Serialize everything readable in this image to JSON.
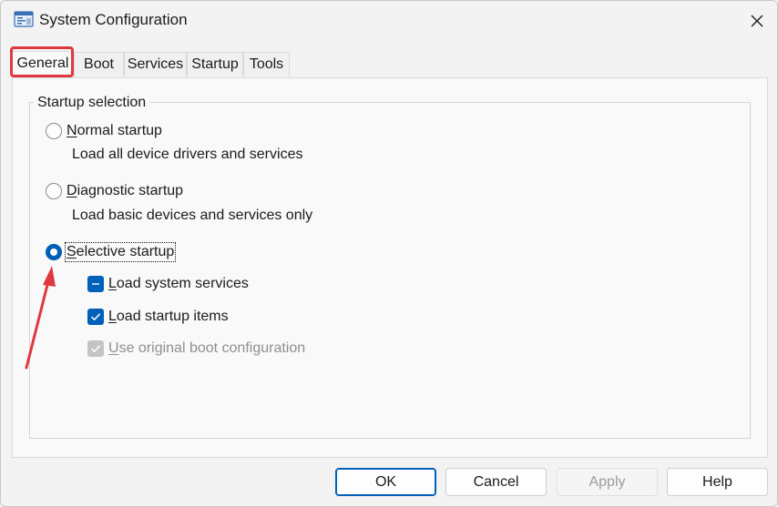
{
  "window": {
    "title": "System Configuration",
    "icon": "msconfig-icon",
    "close_icon": "close-icon"
  },
  "tabs": [
    {
      "label": "General",
      "active": true
    },
    {
      "label": "Boot",
      "active": false
    },
    {
      "label": "Services",
      "active": false
    },
    {
      "label": "Startup",
      "active": false
    },
    {
      "label": "Tools",
      "active": false
    }
  ],
  "startup_selection": {
    "legend": "Startup selection",
    "normal": {
      "label_first": "N",
      "label_rest": "ormal startup",
      "description": "Load all device drivers and services",
      "checked": false
    },
    "diagnostic": {
      "label_first": "D",
      "label_rest": "iagnostic startup",
      "description": "Load basic devices and services only",
      "checked": false
    },
    "selective": {
      "label_first": "S",
      "label_rest": "elective startup",
      "checked": true,
      "options": {
        "system_services": {
          "label_first": "L",
          "label_rest": "oad system services",
          "state": "indeterminate"
        },
        "startup_items": {
          "label_first": "L",
          "label_rest": "oad startup items",
          "state": "checked"
        },
        "original_boot": {
          "label_first": "U",
          "label_rest": "se original boot configuration",
          "state": "checked-disabled"
        }
      }
    }
  },
  "buttons": {
    "ok": "OK",
    "cancel": "Cancel",
    "apply": "Apply",
    "help": "Help"
  },
  "colors": {
    "accent": "#005fb8",
    "highlight": "#e0383e"
  }
}
